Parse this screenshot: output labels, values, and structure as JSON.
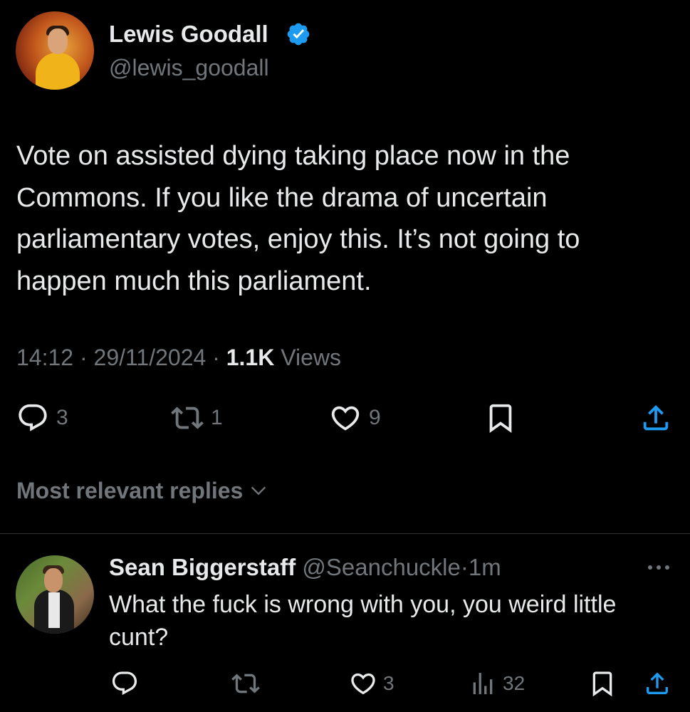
{
  "tweet": {
    "author": {
      "name": "Lewis Goodall",
      "handle": "@lewis_goodall",
      "verified": true
    },
    "text": "Vote on assisted dying taking place now in the Commons. If you like the drama of uncertain parliamentary votes, enjoy this. It’s not going to happen much this parliament.",
    "time": "14:12",
    "date": "29/11/2024",
    "views_count": "1.1K",
    "views_label": "Views",
    "separator": "·",
    "actions": {
      "replies": "3",
      "reposts": "1",
      "likes": "9"
    }
  },
  "replies_section": {
    "sort_label": "Most relevant replies"
  },
  "reply": {
    "name": "Sean Biggerstaff",
    "handle": "@Seanchuckle",
    "separator": "·",
    "time": "1m",
    "text": "What the fuck is wrong with you, you weird little cunt?",
    "actions": {
      "likes": "3",
      "views": "32"
    }
  },
  "colors": {
    "background": "#000000",
    "text_primary": "#e7e9ea",
    "text_secondary": "#71767b",
    "verified_blue": "#1d9bf0",
    "divider": "#2f3336"
  },
  "icons": {
    "reply": "speech-bubble-icon",
    "repost": "repost-arrows-icon",
    "like": "heart-icon",
    "bookmark": "bookmark-icon",
    "share": "share-upload-icon",
    "views": "bar-chart-icon",
    "more": "more-dots-icon",
    "sort": "chevron-down-icon",
    "verified": "verified-badge-icon"
  }
}
